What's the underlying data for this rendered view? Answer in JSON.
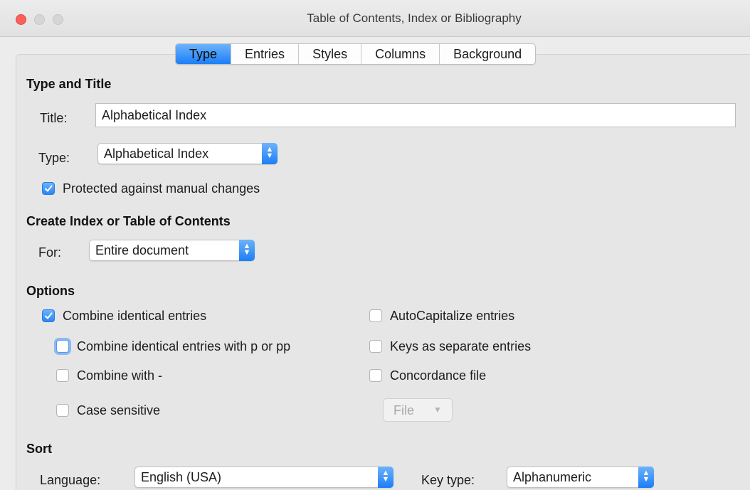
{
  "window": {
    "title": "Table of Contents, Index or Bibliography"
  },
  "tabs": [
    {
      "label": "Type",
      "active": true
    },
    {
      "label": "Entries",
      "active": false
    },
    {
      "label": "Styles",
      "active": false
    },
    {
      "label": "Columns",
      "active": false
    },
    {
      "label": "Background",
      "active": false
    }
  ],
  "type_and_title": {
    "heading": "Type and Title",
    "title_label": "Title:",
    "title_value": "Alphabetical Index",
    "type_label": "Type:",
    "type_value": "Alphabetical Index",
    "protected_label": "Protected against manual changes",
    "protected_checked": true
  },
  "create": {
    "heading": "Create Index or Table of Contents",
    "for_label": "For:",
    "for_value": "Entire document"
  },
  "options": {
    "heading": "Options",
    "combine_identical": {
      "label": "Combine identical entries",
      "checked": true
    },
    "combine_p_pp": {
      "label": "Combine identical entries with p or pp",
      "checked": false
    },
    "combine_with_dash": {
      "label": "Combine with -",
      "checked": false
    },
    "case_sensitive": {
      "label": "Case sensitive",
      "checked": false
    },
    "autocapitalize": {
      "label": "AutoCapitalize entries",
      "checked": false
    },
    "keys_separate": {
      "label": "Keys as separate entries",
      "checked": false
    },
    "concordance": {
      "label": "Concordance file",
      "checked": false
    },
    "file_button": "File"
  },
  "sort": {
    "heading": "Sort",
    "language_label": "Language:",
    "language_value": "English (USA)",
    "key_type_label": "Key type:",
    "key_type_value": "Alphanumeric"
  },
  "colors": {
    "accent": "#1c7ef6",
    "close_button": "#fc605c"
  }
}
